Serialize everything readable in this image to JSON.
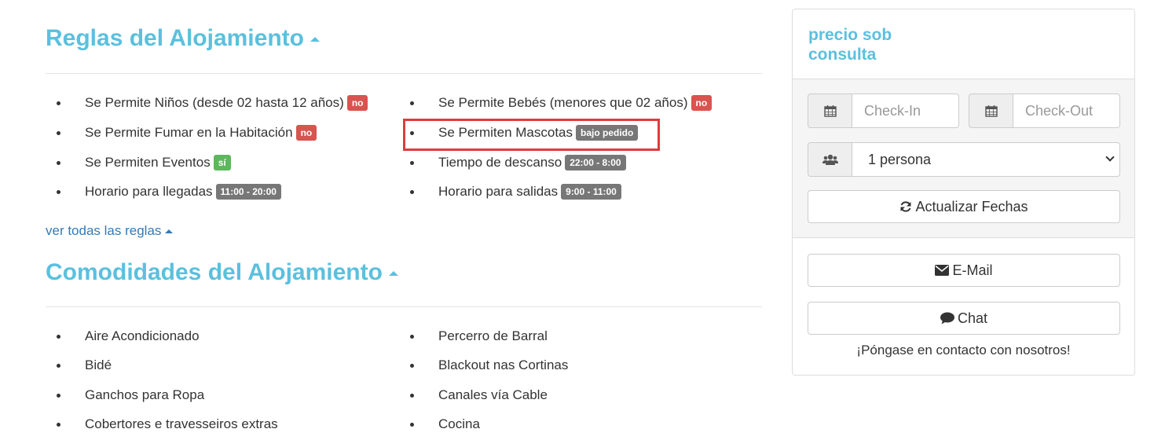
{
  "rules_section": {
    "title": "Reglas del Alojamiento",
    "left_items": [
      {
        "label": "Se Permite Niños (desde 02 hasta 12 años)",
        "badge": "no",
        "badge_type": "no"
      },
      {
        "label": "Se Permite Fumar en la Habitación",
        "badge": "no",
        "badge_type": "no"
      },
      {
        "label": "Se Permiten Eventos",
        "badge": "sí",
        "badge_type": "si"
      },
      {
        "label": "Horario para llegadas",
        "badge": "11:00 - 20:00",
        "badge_type": "gray"
      }
    ],
    "right_items": [
      {
        "label": "Se Permite Bebés (menores que 02 años)",
        "badge": "no",
        "badge_type": "no"
      },
      {
        "label": "Se Permiten Mascotas",
        "badge": "bajo pedido",
        "badge_type": "gray"
      },
      {
        "label": "Tiempo de descanso",
        "badge": "22:00 - 8:00",
        "badge_type": "gray"
      },
      {
        "label": "Horario para salidas",
        "badge": "9:00 - 11:00",
        "badge_type": "gray"
      }
    ],
    "see_all_link": "ver todas las reglas"
  },
  "amenities_section": {
    "title": "Comodidades del Alojamiento",
    "left_items": [
      "Aire Acondicionado",
      "Bidé",
      "Ganchos para Ropa",
      "Cobertores e travesseiros extras"
    ],
    "right_items": [
      "Percerro de Barral",
      "Blackout nas Cortinas",
      "Canales vía Cable",
      "Cocina"
    ]
  },
  "sidebar": {
    "price": "precio sob consulta",
    "checkin_placeholder": "Check-In",
    "checkout_placeholder": "Check-Out",
    "guests_value": "1 persona",
    "update_button": "Actualizar Fechas",
    "email_button": "E-Mail",
    "chat_button": "Chat",
    "contact_text": "¡Póngase en contacto con nosotros!"
  },
  "colors": {
    "accent": "#5bc0de",
    "badge_no": "#d9534f",
    "badge_si": "#5cb85c",
    "badge_gray": "#777777",
    "highlight": "#e03a3e",
    "link": "#337ab7"
  },
  "icons": {
    "calendar": "calendar-icon",
    "users": "users-icon",
    "refresh": "refresh-icon",
    "envelope": "envelope-icon",
    "chat": "comment-icon",
    "caret": "caret-up-icon"
  }
}
